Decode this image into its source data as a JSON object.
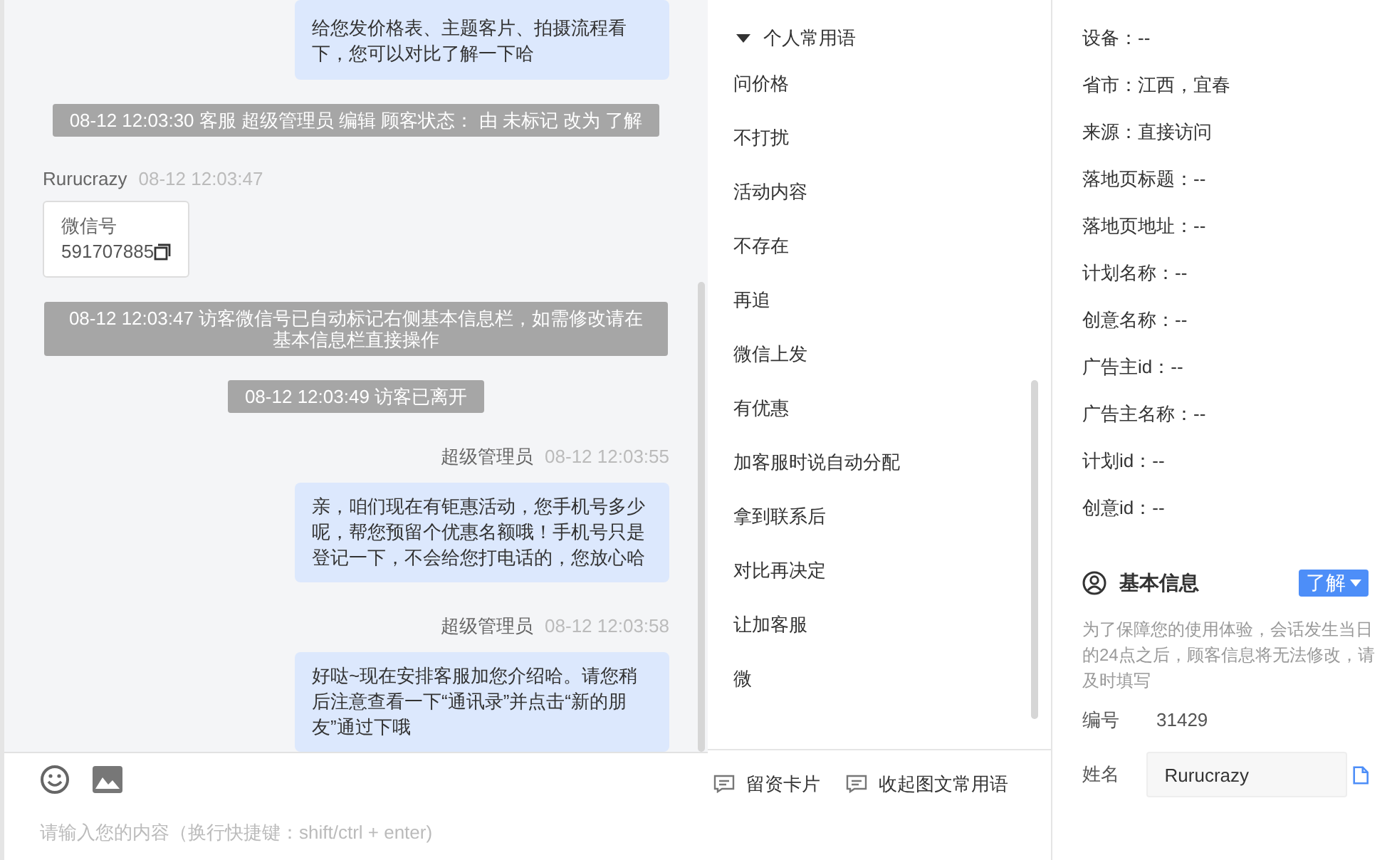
{
  "chat": {
    "messages": [
      {
        "kind": "outgoing",
        "text": "给您发价格表、主题客片、拍摄流程看下，您可以对比了解一下哈"
      },
      {
        "kind": "system",
        "text": "08-12 12:03:30 客服 超级管理员 编辑 顾客状态： 由 未标记 改为 了解"
      },
      {
        "kind": "card",
        "sender": "Rurucrazy",
        "time": "08-12 12:03:47",
        "label": "微信号",
        "value": "591707885"
      },
      {
        "kind": "system",
        "text": "08-12 12:03:47 访客微信号已自动标记右侧基本信息栏，如需修改请在基本信息栏直接操作"
      },
      {
        "kind": "system",
        "text": "08-12 12:03:49 访客已离开"
      },
      {
        "kind": "outgoing",
        "sender": "超级管理员",
        "time": "08-12 12:03:55",
        "text": "亲，咱们现在有钜惠活动，您手机号多少呢，帮您预留个优惠名额哦！手机号只是登记一下，不会给您打电话的，您放心哈"
      },
      {
        "kind": "outgoing",
        "sender": "超级管理员",
        "time": "08-12 12:03:58",
        "text": "好哒~现在安排客服加您介绍哈。请您稍后注意查看一下“通讯录”并点击“新的朋友”通过下哦"
      }
    ],
    "input": {
      "placeholder": "请输入您的内容（换行快捷键：shift/ctrl + enter)"
    }
  },
  "phrases": {
    "group": {
      "label": "个人常用语",
      "expanded": true
    },
    "items": [
      "问价格",
      "不打扰",
      "活动内容",
      "不存在",
      "再追",
      "微信上发",
      "有优惠",
      "加客服时说自动分配",
      "拿到联系后",
      "对比再决定",
      "让加客服",
      "微"
    ],
    "buttons": [
      "留资卡片",
      "收起图文常用语"
    ]
  },
  "info": {
    "fields": [
      "设备：--",
      "省市：江西，宜春",
      "来源：直接访问",
      "落地页标题：--",
      "落地页地址：--",
      "计划名称：--",
      "创意名称：--",
      "广告主id：--",
      "广告主名称：--",
      "计划id：--",
      "创意id：--"
    ],
    "basic": {
      "title": "基本信息",
      "status": "了解",
      "note": "为了保障您的使用体验，会话发生当日的24点之后，顾客信息将无法修改，请及时填写",
      "number_label": "编号",
      "number": "31429",
      "name_label": "姓名",
      "name": "Rurucrazy"
    }
  }
}
